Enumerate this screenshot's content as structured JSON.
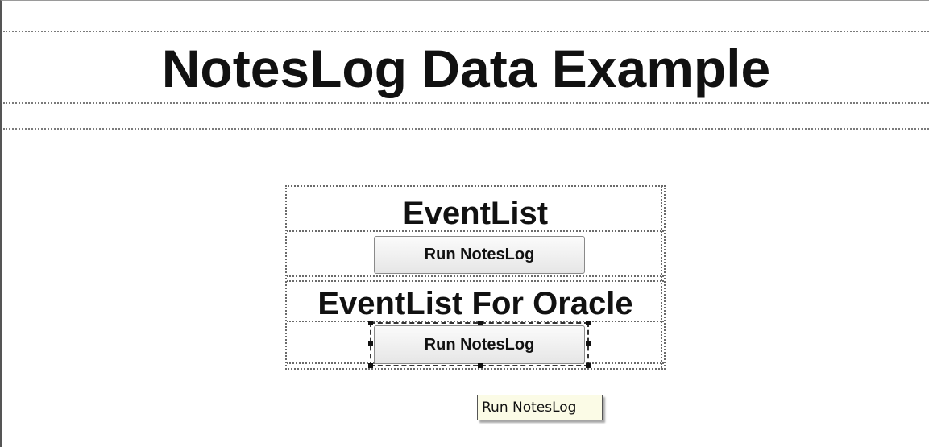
{
  "page": {
    "title": "NotesLog Data Example"
  },
  "sections": [
    {
      "label": "EventList",
      "button_label": "Run NotesLog"
    },
    {
      "label": "EventList For Oracle",
      "button_label": "Run NotesLog"
    }
  ],
  "tooltip": {
    "text": "Run NotesLog"
  }
}
